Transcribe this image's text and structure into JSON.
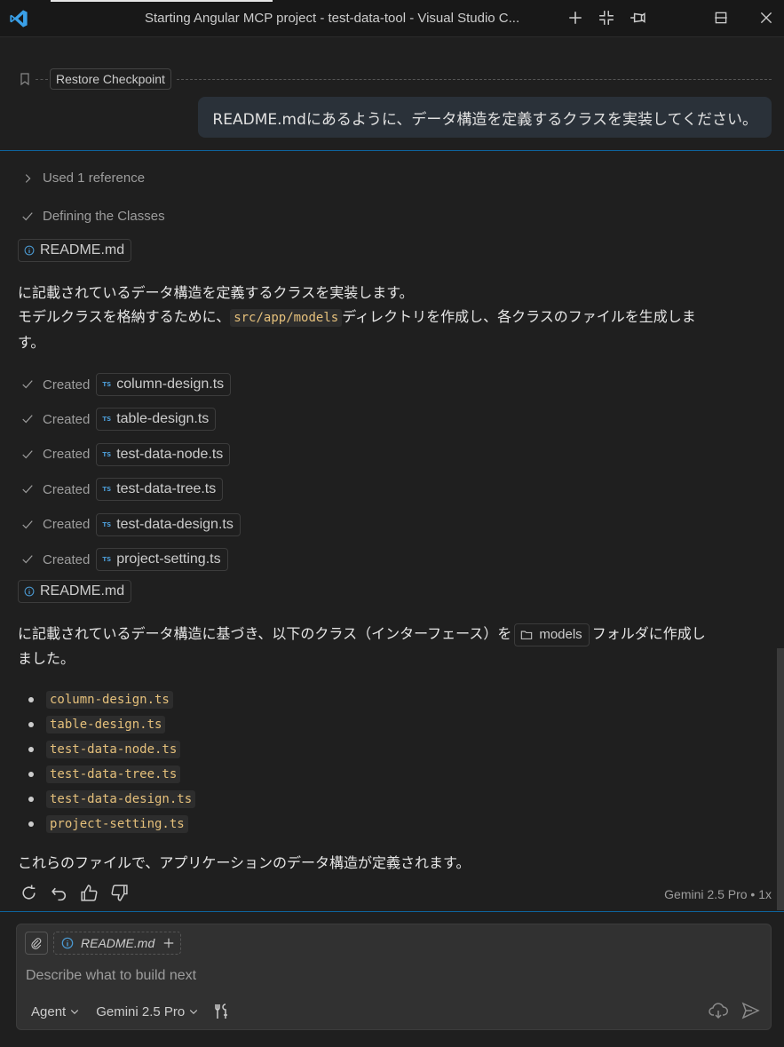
{
  "window": {
    "title": "Starting Angular MCP project - test-data-tool - Visual Studio C..."
  },
  "checkpoint": {
    "label": "Restore Checkpoint"
  },
  "user_message": "README.mdにあるように、データ構造を定義するクラスを実装してください。",
  "references": {
    "label": "Used 1 reference"
  },
  "status": {
    "label": "Defining the Classes"
  },
  "readme_chip": "README.md",
  "para1": {
    "line1": "に記載されているデータ構造を定義するクラスを実装します。",
    "line2_a": "モデルクラスを格納するために、",
    "line2_code": "src/app/models",
    "line2_b": "ディレクトリを作成し、各クラスのファイルを生成しま",
    "line3": "す。"
  },
  "created_label": "Created",
  "created_files": [
    "column-design.ts",
    "table-design.ts",
    "test-data-node.ts",
    "test-data-tree.ts",
    "test-data-design.ts",
    "project-setting.ts"
  ],
  "ts_icon_text": "TS",
  "para2": {
    "a": "に記載されているデータ構造に基づき、以下のクラス（インターフェース）を",
    "folder": "models",
    "b": "フォルダに作成し",
    "c": "ました。"
  },
  "bullets": [
    "column-design.ts",
    "table-design.ts",
    "test-data-node.ts",
    "test-data-tree.ts",
    "test-data-design.ts",
    "project-setting.ts"
  ],
  "para3": "これらのファイルで、アプリケーションのデータ構造が定義されます。",
  "model_tag": "Gemini 2.5 Pro • 1x",
  "input": {
    "context_chip": "README.md",
    "placeholder": "Describe what to build next",
    "mode": "Agent",
    "model": "Gemini 2.5 Pro"
  },
  "colors": {
    "accent": "#0e639c",
    "code": "#e5c07b",
    "ts": "#4b9ad3"
  }
}
